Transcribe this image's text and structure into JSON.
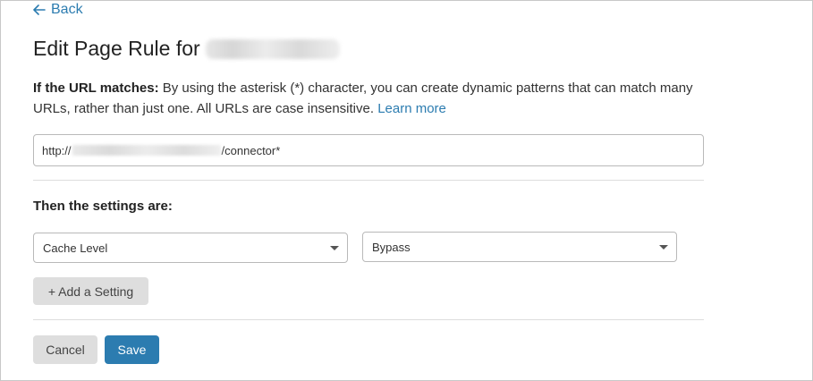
{
  "nav": {
    "back_label": "Back"
  },
  "header": {
    "title": "Edit Page Rule for"
  },
  "description": {
    "lead": "If the URL matches:",
    "body": " By using the asterisk (*) character, you can create dynamic patterns that can match many URLs, rather than just one. All URLs are case insensitive. ",
    "link": "Learn more"
  },
  "url_field": {
    "prefix": "http://",
    "suffix": "/connector*"
  },
  "settings": {
    "label": "Then the settings are:",
    "setting_select": "Cache Level",
    "value_select": "Bypass",
    "add_setting_label": "+ Add a Setting"
  },
  "actions": {
    "cancel_label": "Cancel",
    "save_label": "Save"
  },
  "colors": {
    "accent": "#2c7cb0",
    "button_gray": "#dedede"
  }
}
